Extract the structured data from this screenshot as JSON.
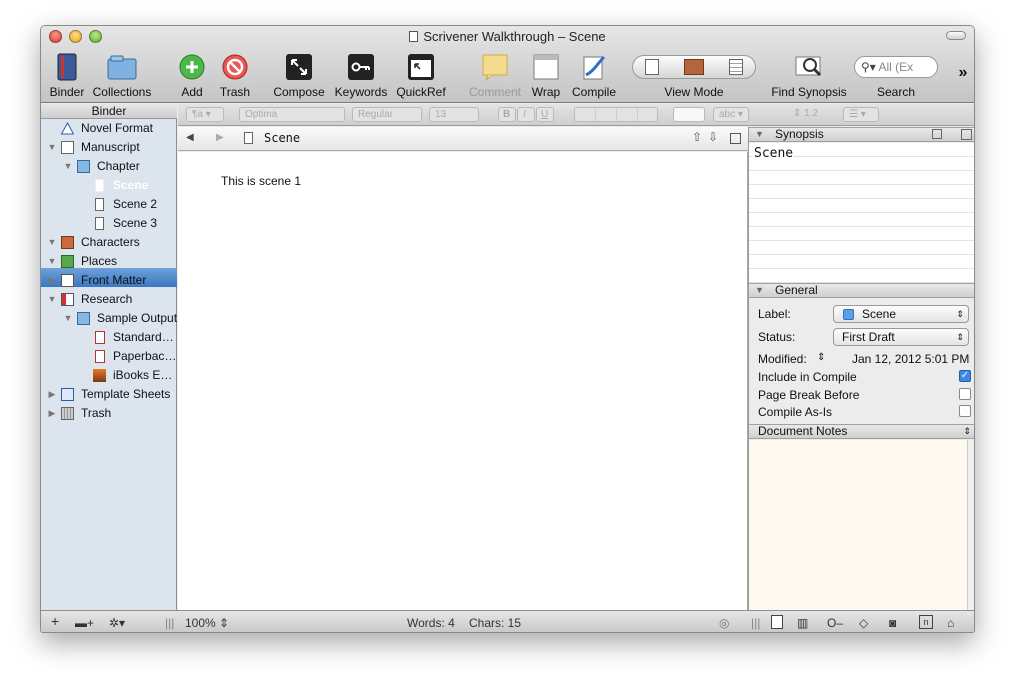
{
  "window": {
    "title": "Scrivener Walkthrough – Scene"
  },
  "toolbar": {
    "binder": "Binder",
    "collections": "Collections",
    "add": "Add",
    "trash": "Trash",
    "compose": "Compose",
    "keywords": "Keywords",
    "quickref": "QuickRef",
    "comment": "Comment",
    "wrap": "Wrap",
    "compile": "Compile",
    "view_mode": "View Mode",
    "find_synopsis": "Find Synopsis",
    "search": "Search",
    "search_placeholder": "All (Ex",
    "overflow": "»"
  },
  "format_bar": {
    "style": "¶a",
    "font": "Optima",
    "weight": "Regular",
    "size": "13",
    "bold": "B",
    "italic": "I",
    "underline": "U",
    "highlight": "abc",
    "line_spacing": "1.2"
  },
  "binder": {
    "header": "Binder",
    "items": [
      {
        "label": "Novel Format"
      },
      {
        "label": "Manuscript"
      },
      {
        "label": "Chapter"
      },
      {
        "label": "Scene"
      },
      {
        "label": "Scene 2"
      },
      {
        "label": "Scene 3"
      },
      {
        "label": "Characters"
      },
      {
        "label": "Places"
      },
      {
        "label": "Front Matter"
      },
      {
        "label": "Research"
      },
      {
        "label": "Sample Output"
      },
      {
        "label": "Standard…"
      },
      {
        "label": "Paperbac…"
      },
      {
        "label": "iBooks E…"
      },
      {
        "label": "Template Sheets"
      },
      {
        "label": "Trash"
      }
    ]
  },
  "editor": {
    "header_title": "Scene",
    "body": "This is scene 1"
  },
  "inspector": {
    "synopsis_header": "Synopsis",
    "synopsis_title": "Scene",
    "general_header": "General",
    "label_key": "Label:",
    "label_value": "Scene",
    "status_key": "Status:",
    "status_value": "First Draft",
    "modified_key": "Modified:",
    "modified_value": "Jan 12, 2012 5:01 PM",
    "include_in_compile": "Include in Compile",
    "include_checked": true,
    "page_break_before": "Page Break Before",
    "compile_as_is": "Compile As-Is",
    "notes_header": "Document Notes"
  },
  "status_bar": {
    "zoom": "100%",
    "words": "Words: 4",
    "chars": "Chars: 15"
  },
  "colors": {
    "selection": "#3b76c2",
    "binder_bg": "#dce4ee",
    "notes_bg": "#fdf9ee",
    "label_swatch": "#5aa0e6"
  }
}
